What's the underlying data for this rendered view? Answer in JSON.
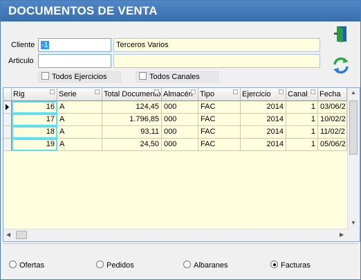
{
  "window": {
    "title": "DOCUMENTOS DE VENTA"
  },
  "form": {
    "cliente_label": "Cliente",
    "cliente_code": "-1",
    "cliente_name": "Terceros Varios",
    "articulo_label": "Articulo",
    "articulo_code": "",
    "articulo_name": "",
    "todos_ejercicios_label": "Todos Ejercicios",
    "todos_canales_label": "Todos Canales"
  },
  "icons": {
    "exit": "exit-door-icon",
    "refresh": "refresh-icon"
  },
  "grid": {
    "columns": [
      "Rig",
      "Serie",
      "Total Documento",
      "Almacén",
      "Tipo",
      "Ejercicio",
      "Canal",
      "Fecha"
    ],
    "rows": [
      [
        "16",
        "A",
        "124,45",
        "000",
        "FAC",
        "2014",
        "1",
        "03/06/2"
      ],
      [
        "17",
        "A",
        "1.796,85",
        "000",
        "FAC",
        "2014",
        "1",
        "10/02/2"
      ],
      [
        "18",
        "A",
        "93,11",
        "000",
        "FAC",
        "2014",
        "1",
        "11/02/2"
      ],
      [
        "19",
        "A",
        "24,50",
        "000",
        "FAC",
        "2014",
        "1",
        "05/06/2"
      ]
    ]
  },
  "filters": {
    "ofertas": "Ofertas",
    "pedidos": "Pedidos",
    "albaranes": "Albaranes",
    "facturas": "Facturas",
    "selected": "facturas"
  }
}
